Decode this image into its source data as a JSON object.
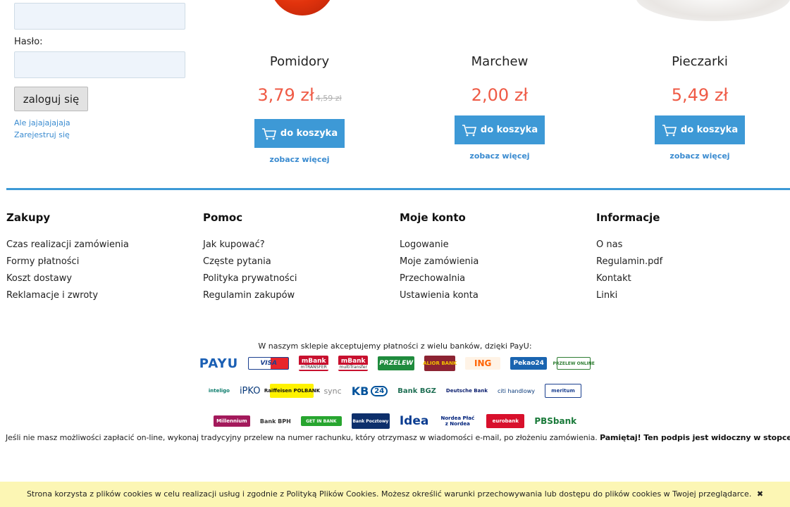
{
  "login": {
    "password_label": "Hasło:",
    "button": "zaloguj się",
    "forgot_link": "Ale jajajajajaja",
    "register_link": "Zarejestruj się"
  },
  "products": [
    {
      "name": "Pomidory",
      "price": "3,79 zł",
      "old_price": "4,59 zł",
      "cart": "do koszyka",
      "more": "zobacz więcej"
    },
    {
      "name": "Marchew",
      "price": "2,00 zł",
      "old_price": "",
      "cart": "do koszyka",
      "more": "zobacz więcej"
    },
    {
      "name": "Pieczarki",
      "price": "5,49 zł",
      "old_price": "",
      "cart": "do koszyka",
      "more": "zobacz więcej"
    }
  ],
  "footer": {
    "columns": [
      {
        "title": "Zakupy",
        "links": [
          "Czas realizacji zamówienia",
          "Formy płatności",
          "Koszt dostawy",
          "Reklamacje i zwroty"
        ]
      },
      {
        "title": "Pomoc",
        "links": [
          "Jak kupować?",
          "Częste pytania",
          "Polityka prywatności",
          "Regulamin zakupów"
        ]
      },
      {
        "title": "Moje konto",
        "links": [
          "Logowanie",
          "Moje zamówienia",
          "Przechowalnia",
          "Ustawienia konta"
        ]
      },
      {
        "title": "Informacje",
        "links": [
          "O nas",
          "Regulamin.pdf",
          "Kontakt",
          "Linki"
        ]
      }
    ]
  },
  "payment": {
    "intro": "W naszym sklepie akceptujemy płatności z wielu banków, dzięki PayU:",
    "logos": {
      "payu": "PAYU",
      "visa": "VISA",
      "mbank1": "mBank",
      "mbank1_sub": "mTRANSFER",
      "mbank2": "mBank",
      "mbank2_sub": "multiTransfer",
      "przelew_wbk": "PRZELEW",
      "alior": "ALIOR BANK",
      "ing": "ING",
      "pekao": "Pekao24",
      "przelew_online": "PRZELEW ONLINE",
      "inteligo": "inteligo",
      "ipko": "iPKO",
      "raiffeisen": "Raiffeisen POLBANK",
      "sync": "sync",
      "kb24": "KB",
      "bgz": "Bank BGZ",
      "deutsche": "Deutsche Bank",
      "citi": "citi handlowy",
      "meritum": "meritum",
      "millennium": "Millennium",
      "bph": "Bank BPH",
      "getin": "GET IN BANK",
      "pocztowy": "Bank Pocztowy",
      "idea": "Idea",
      "nordea": "Nordea Płać z Nordea",
      "eurobank": "eurobank",
      "pbs": "PBSbank"
    },
    "note_plain": "Jeśli nie masz możliwości zapłacić on-line, wykonaj tradycyjny przelew na numer rachunku, który otrzymasz w wiadomości e-mail, po złożeniu zamówienia.",
    "note_bold": "Pamiętaj! Ten podpis jest widoczny w stopce strony!"
  },
  "cookie": {
    "text": "Strona korzysta z plików cookies w celu realizacji usług i zgodnie z Polityką Plików Cookies. Możesz określić warunki przechowywania lub dostępu do plików cookies w Twojej przeglądarce.",
    "close": "✖"
  }
}
